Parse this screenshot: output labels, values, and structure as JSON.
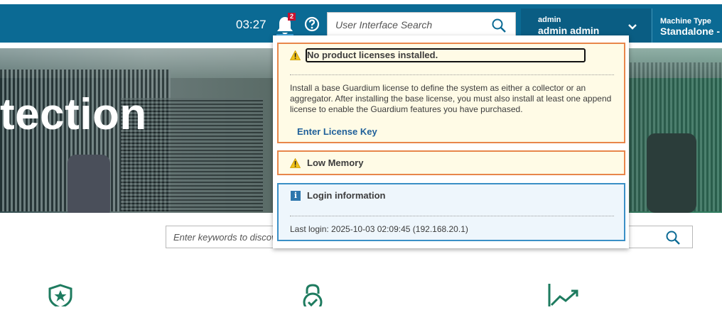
{
  "header": {
    "time": "03:27",
    "notification_count": "2",
    "search_placeholder": "User Interface Search",
    "user_small": "admin",
    "user_name": "admin admin",
    "machine_type_label": "Machine Type",
    "machine_type_value": "Standalone -"
  },
  "hero": {
    "title": "tection"
  },
  "keyword_search": {
    "placeholder": "Enter keywords to discov"
  },
  "notifications": [
    {
      "type": "warning",
      "title": "No product licenses installed.",
      "body": "Install a base Guardium license to define the system as either a collector or an aggregator. After installing the base license, you must also install at least one append license to enable the Guardium features you have purchased.",
      "link": "Enter License Key"
    },
    {
      "type": "warning",
      "title": "Low Memory"
    },
    {
      "type": "info",
      "title": "Login information",
      "body": "Last login: 2025-10-03 02:09:45 (192.168.20.1)"
    }
  ],
  "icons": {
    "notification": "bell-icon",
    "help": "help-icon",
    "search": "search-icon",
    "user_menu": "chevron-down-icon",
    "warning": "warning-icon",
    "info": "info-icon",
    "feature_1": "shield-star-icon",
    "feature_2": "lock-check-icon",
    "feature_3": "trend-chart-icon"
  },
  "colors": {
    "header": "#0b6a94",
    "user_box": "#0a5d83",
    "warning_border": "#e8864a",
    "info_border": "#3a8fc6",
    "link": "#1f5f99",
    "icon_green": "#1e7b5f",
    "badge": "#c8102e"
  }
}
